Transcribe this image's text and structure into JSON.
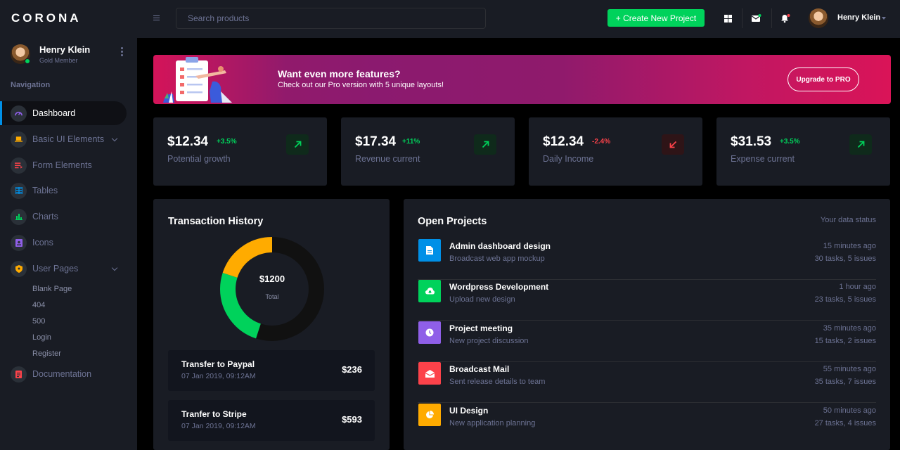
{
  "brand": "CORONA",
  "sidebar": {
    "profile": {
      "name": "Henry Klein",
      "role": "Gold Member"
    },
    "heading": "Navigation",
    "items": [
      {
        "label": "Dashboard",
        "icon": "speedometer-icon",
        "color": "#8f5fe8"
      },
      {
        "label": "Basic UI Elements",
        "icon": "laptop-icon",
        "color": "#ffab00"
      },
      {
        "label": "Form Elements",
        "icon": "playlist-icon",
        "color": "#fc424a"
      },
      {
        "label": "Tables",
        "icon": "table-icon",
        "color": "#0090e7"
      },
      {
        "label": "Charts",
        "icon": "chart-bar-icon",
        "color": "#00d25b"
      },
      {
        "label": "Icons",
        "icon": "contacts-icon",
        "color": "#8f5fe8"
      },
      {
        "label": "User Pages",
        "icon": "security-icon",
        "color": "#ffab00"
      },
      {
        "label": "Documentation",
        "icon": "file-document-icon",
        "color": "#fc424a"
      }
    ],
    "sub_items": [
      "Blank Page",
      "404",
      "500",
      "Login",
      "Register"
    ]
  },
  "topbar": {
    "search_placeholder": "Search products",
    "create_label": "+ Create New Project",
    "user_name": "Henry Klein"
  },
  "banner": {
    "title": "Want even more features?",
    "subtitle": "Check out our Pro version with 5 unique layouts!",
    "button": "Upgrade to PRO"
  },
  "stats": [
    {
      "value": "$12.34",
      "delta": "+3.5%",
      "label": "Potential growth",
      "trend": "up",
      "color": "#00d25b"
    },
    {
      "value": "$17.34",
      "delta": "+11%",
      "label": "Revenue current",
      "trend": "up",
      "color": "#00d25b"
    },
    {
      "value": "$12.34",
      "delta": "-2.4%",
      "label": "Daily Income",
      "trend": "down",
      "color": "#fc424a"
    },
    {
      "value": "$31.53",
      "delta": "+3.5%",
      "label": "Expense current",
      "trend": "up",
      "color": "#00d25b"
    }
  ],
  "transactions": {
    "title": "Transaction History",
    "total_value": "$1200",
    "total_label": "Total",
    "chart_segments": [
      {
        "value": 55,
        "color": "#111111"
      },
      {
        "value": 25,
        "color": "#00d25b"
      },
      {
        "value": 20,
        "color": "#ffab00"
      }
    ],
    "rows": [
      {
        "title": "Transfer to Paypal",
        "date": "07 Jan 2019, 09:12AM",
        "amount": "$236"
      },
      {
        "title": "Tranfer to Stripe",
        "date": "07 Jan 2019, 09:12AM",
        "amount": "$593"
      }
    ]
  },
  "projects": {
    "title": "Open Projects",
    "status_link": "Your data status",
    "items": [
      {
        "title": "Admin dashboard design",
        "subtitle": "Broadcast web app mockup",
        "time": "15 minutes ago",
        "tasks": "30 tasks, 5 issues",
        "color": "#0090e7",
        "icon": "file-icon"
      },
      {
        "title": "Wordpress Development",
        "subtitle": "Upload new design",
        "time": "1 hour ago",
        "tasks": "23 tasks, 5 issues",
        "color": "#00d25b",
        "icon": "cloud-download-icon"
      },
      {
        "title": "Project meeting",
        "subtitle": "New project discussion",
        "time": "35 minutes ago",
        "tasks": "15 tasks, 2 issues",
        "color": "#8f5fe8",
        "icon": "clock-icon"
      },
      {
        "title": "Broadcast Mail",
        "subtitle": "Sent release details to team",
        "time": "55 minutes ago",
        "tasks": "35 tasks, 7 issues",
        "color": "#fc424a",
        "icon": "email-open-icon"
      },
      {
        "title": "UI Design",
        "subtitle": "New application planning",
        "time": "50 minutes ago",
        "tasks": "27 tasks, 4 issues",
        "color": "#ffab00",
        "icon": "chart-pie-icon"
      }
    ]
  }
}
